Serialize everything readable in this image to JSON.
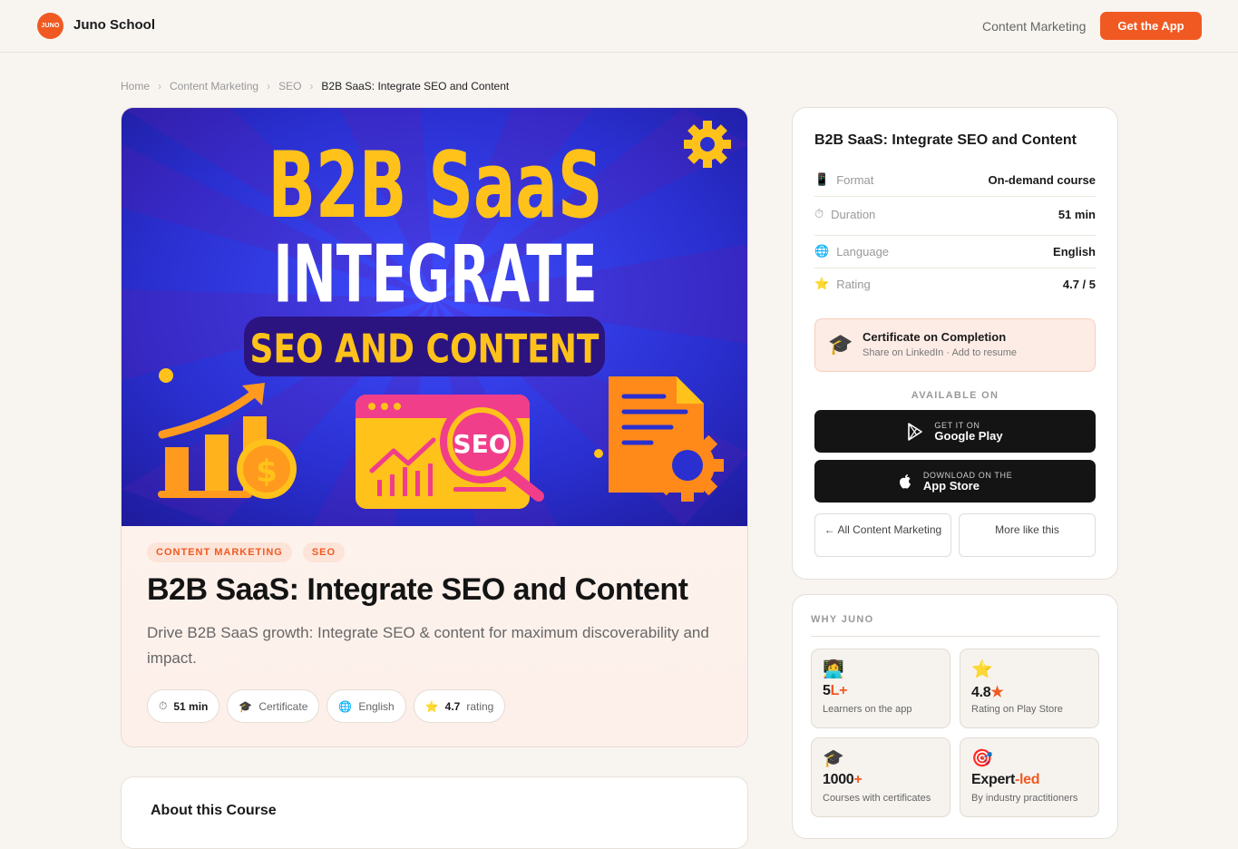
{
  "header": {
    "logo_text": "JUNO",
    "brand": "Juno School",
    "nav_link": "Content Marketing",
    "cta": "Get the App"
  },
  "breadcrumb": [
    "Home",
    "Content Marketing",
    "SEO",
    "B2B SaaS: Integrate SEO and Content"
  ],
  "banner": {
    "line1": "B2B SaaS",
    "line2": "INTEGRATE",
    "line3": "SEO AND CONTENT",
    "badge": "SEO",
    "colors": {
      "bg": "#2a2fd0",
      "accent": "#ffc21a",
      "orange": "#ff8a1a"
    }
  },
  "course": {
    "tags": [
      "CONTENT MARKETING",
      "SEO"
    ],
    "title": "B2B SaaS: Integrate SEO and Content",
    "subtitle": "Drive B2B SaaS growth: Integrate SEO & content for maximum discoverability and impact.",
    "chips": {
      "duration": "51 min",
      "certificate": "Certificate",
      "language": "English",
      "rating_value": "4.7",
      "rating_label": "rating"
    }
  },
  "about": {
    "heading": "About this Course"
  },
  "side": {
    "title": "B2B SaaS: Integrate SEO and Content",
    "rows": [
      {
        "icon": "mobile-icon",
        "key": "Format",
        "value": "On-demand course"
      },
      {
        "icon": "stopwatch-icon",
        "key": "Duration",
        "value": "51 min"
      },
      {
        "icon": "globe-icon",
        "key": "Language",
        "value": "English"
      },
      {
        "icon": "star-icon",
        "key": "Rating",
        "value": "4.7 / 5"
      }
    ],
    "certificate": {
      "title": "Certificate on Completion",
      "sub": "Share on LinkedIn · Add to resume"
    },
    "available_on": "AVAILABLE ON",
    "google": {
      "small": "GET IT ON",
      "big": "Google Play"
    },
    "apple": {
      "small": "DOWNLOAD ON THE",
      "big": "App Store"
    },
    "btn_all": "← All Content Marketing",
    "btn_more": "More like this"
  },
  "why": {
    "heading": "WHY JUNO",
    "stats": [
      {
        "icon": "learner-icon",
        "num": "5",
        "acc": "L+",
        "label": "Learners on the app"
      },
      {
        "icon": "star-icon",
        "num": "4.8",
        "acc": "★",
        "label": "Rating on Play Store"
      },
      {
        "icon": "grad-cap-icon",
        "num": "1000",
        "acc": "+",
        "label": "Courses with certificates"
      },
      {
        "icon": "target-icon",
        "num": "Expert",
        "acc": "-led",
        "label": "By industry practitioners"
      }
    ]
  },
  "accent_color": "#f05a22"
}
